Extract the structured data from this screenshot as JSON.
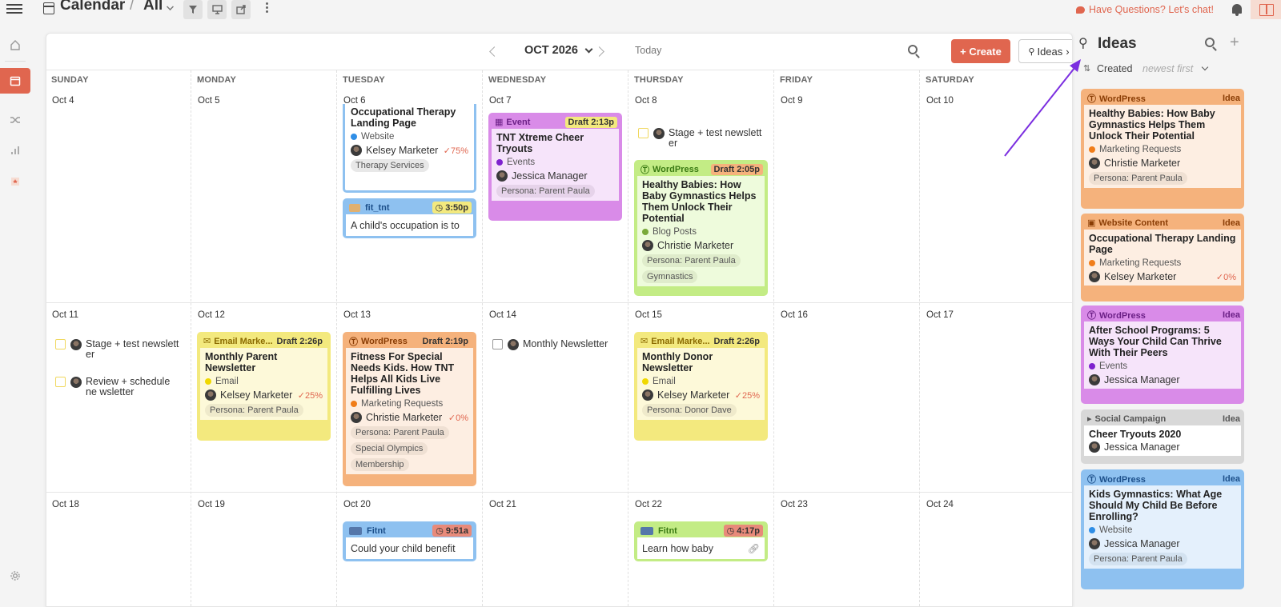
{
  "header": {
    "title": "Calendar",
    "separator": "/",
    "view": "All",
    "help": "Have Questions? Let's chat!"
  },
  "toolbar": {
    "month": "OCT 2026",
    "today": "Today",
    "create": "+ Create",
    "ideas": "Ideas"
  },
  "days": [
    "SUNDAY",
    "MONDAY",
    "TUESDAY",
    "WEDNESDAY",
    "THURSDAY",
    "FRIDAY",
    "SATURDAY"
  ],
  "dates": {
    "w1": [
      "Oct 4",
      "Oct 5",
      "Oct 6",
      "Oct 7",
      "Oct 8",
      "Oct 9",
      "Oct 10"
    ],
    "w2": [
      "Oct 11",
      "Oct 12",
      "Oct 13",
      "Oct 14",
      "Oct 15",
      "Oct 16",
      "Oct 17"
    ],
    "w3": [
      "Oct 18",
      "Oct 19",
      "Oct 20",
      "Oct 21",
      "Oct 22",
      "Oct 23",
      "Oct 24"
    ]
  },
  "cards": {
    "otl": {
      "title": "Occupational Therapy Landing Page",
      "category": "Website",
      "person": "Kelsey Marketer",
      "progress": "75%",
      "tag": "Therapy Services"
    },
    "fit": {
      "account": "fit_tnt",
      "time": "3:50p",
      "text": "A child's occupation is to"
    },
    "tnt": {
      "type": "Event",
      "status": "Draft",
      "time": "2:13p",
      "title": "TNT Xtreme Cheer Tryouts",
      "category": "Events",
      "person": "Jessica Manager",
      "tag": "Persona: Parent Paula"
    },
    "stage1": {
      "text": "Stage + test newslett er"
    },
    "hb": {
      "type": "WordPress",
      "status": "Draft",
      "time": "2:05p",
      "title": "Healthy Babies: How Baby Gymnastics Helps Them Unlock Their Potential",
      "category": "Blog Posts",
      "person": "Christie Marketer",
      "tag1": "Persona: Parent Paula",
      "tag2": "Gymnastics"
    },
    "stage2": {
      "text": "Stage + test newslett er"
    },
    "review": {
      "text": "Review + schedule ne wsletter"
    },
    "mpn": {
      "type": "Email Marke...",
      "status": "Draft",
      "time": "2:26p",
      "title": "Monthly Parent Newsletter",
      "category": "Email",
      "person": "Kelsey Marketer",
      "progress": "25%",
      "tag": "Persona: Parent Paula"
    },
    "fsn": {
      "type": "WordPress",
      "status": "Draft",
      "time": "2:19p",
      "title": "Fitness For Special Needs Kids. How TNT Helps All Kids Live Fulfilling Lives",
      "category": "Marketing Requests",
      "person": "Christie Marketer",
      "progress": "0%",
      "tag1": "Persona: Parent Paula",
      "tag2": "Special Olympics",
      "tag3": "Membership"
    },
    "mn": {
      "text": "Monthly Newsletter"
    },
    "mdn": {
      "type": "Email Marke...",
      "status": "Draft",
      "time": "2:26p",
      "title": "Monthly Donor Newsletter",
      "category": "Email",
      "person": "Kelsey Marketer",
      "progress": "25%",
      "tag": "Persona: Donor Dave"
    },
    "fitnt1": {
      "account": "Fitnt",
      "time": "9:51a",
      "text": "Could your child benefit"
    },
    "fitnt2": {
      "account": "Fitnt",
      "time": "4:17p",
      "text": "Learn how baby"
    }
  },
  "ideas": {
    "title": "Ideas",
    "sort": "Created",
    "order": "newest first",
    "items": [
      {
        "type": "WordPress",
        "badge": "Idea",
        "title": "Healthy Babies: How Baby Gymnastics Helps Them Unlock Their Potential",
        "category": "Marketing Requests",
        "person": "Christie Marketer",
        "tag": "Persona: Parent Paula"
      },
      {
        "type": "Website Content",
        "badge": "Idea",
        "title": "Occupational Therapy Landing Page",
        "category": "Marketing Requests",
        "person": "Kelsey Marketer",
        "progress": "0%"
      },
      {
        "type": "WordPress",
        "badge": "Idea",
        "title": "After School Programs: 5 Ways Your Child Can Thrive With Their Peers",
        "category": "Events",
        "person": "Jessica Manager"
      },
      {
        "type": "Social Campaign",
        "badge": "Idea",
        "title": "Cheer Tryouts 2020",
        "person": "Jessica Manager"
      },
      {
        "type": "WordPress",
        "badge": "Idea",
        "title": "Kids Gymnastics: What Age Should My Child Be Before Enrolling?",
        "category": "Website",
        "person": "Jessica Manager",
        "tag": "Persona: Parent Paula"
      }
    ]
  },
  "colors": {
    "accent": "#e0664f",
    "wordpress_orange": "#f5b27c",
    "event_purple": "#d98be8",
    "email_yellow": "#f3e97e",
    "blue": "#8ec1f0",
    "green": "#c3ec85",
    "gray": "#d8d8d8"
  }
}
